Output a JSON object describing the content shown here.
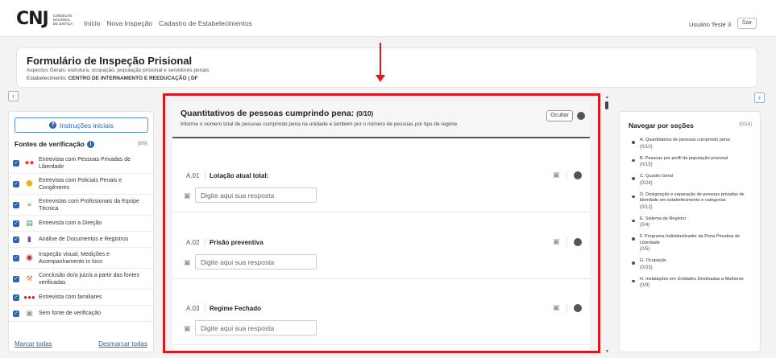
{
  "app": {
    "logo_mark": "CNJ",
    "logo_lines": [
      "CONSELHO",
      "NACIONAL",
      "DE JUSTIÇA"
    ]
  },
  "nav": {
    "items": [
      "Início",
      "Nova Inspeção",
      "Cadastro de Estabelecimentos"
    ]
  },
  "user": {
    "name": "Usuário Teste 3",
    "logout_label": "Sair"
  },
  "header": {
    "title": "Formulário de Inspeção Prisional",
    "subtitle": "Aspectos Gerais: estrutura, ocupação, população prisional e servidores penais",
    "establishment_label": "Estabelecimento:",
    "establishment_value": "CENTRO DE INTERNAMENTO E REEDUCAÇÃO | DF"
  },
  "toggles": {
    "left": "‹",
    "right": "›"
  },
  "left_panel": {
    "instructions_label": "Instruções iniciais",
    "sources_title": "Fontes de verificação",
    "sources_count": "(9/9)",
    "sources": [
      "Entrevista com Pessoas Privadas de Liberdade",
      "Entrevista com Policiais Penais e Congêneres",
      "Entrevistas com Profissionais da Equipe Técnica",
      "Entrevista com a Direção",
      "Análise de Documentos e Registros",
      "Inspeção visual, Medições e Acompanhamento in loco",
      "Conclusão do/a juiz/a a partir das fontes verificadas",
      "Entrevista com familiares",
      "Sem fonte de verificação"
    ],
    "select_all": "Marcar todas",
    "deselect_all": "Desmarcar todas"
  },
  "section": {
    "title": "Quantitativos de pessoas cumprindo pena:",
    "count": "(0/10)",
    "description": "Informe o número total de pessoas cumprindo pena na unidade e também por o número de pessoas por tipo de regime.",
    "hide_label": "Ocultar"
  },
  "questions": [
    {
      "num": "A.01",
      "label": "Lotação atual total:",
      "placeholder": "Digite aqui sua resposta"
    },
    {
      "num": "A.02",
      "label": "Prisão preventiva",
      "placeholder": "Digite aqui sua resposta"
    },
    {
      "num": "A.03",
      "label": "Regime Fechado",
      "placeholder": "Digite aqui sua resposta"
    }
  ],
  "right_panel": {
    "title": "Navegar por seções",
    "count": "(0/14)",
    "sections": [
      {
        "label": "A. Quantitativos de pessoas cumprindo pena:",
        "count": "(0/10)"
      },
      {
        "label": "B. Pessoas por perfil da população prisional",
        "count": "(0/15)"
      },
      {
        "label": "C. Quadro Geral",
        "count": "(0/24)"
      },
      {
        "label": "D. Designação e separação de pessoas privadas de liberdade em estabelecimento e categorias",
        "count": "(0/12)"
      },
      {
        "label": "E. Sistema de Registro",
        "count": "(0/4)"
      },
      {
        "label": "F. Programa Individualizador da Pena Privativa de Liberdade",
        "count": "(0/5)"
      },
      {
        "label": "G. Ocupação",
        "count": "(0/33)"
      },
      {
        "label": "H. Instalações em Unidades Destinadas a Mulheres",
        "count": "(0/9)"
      }
    ]
  }
}
